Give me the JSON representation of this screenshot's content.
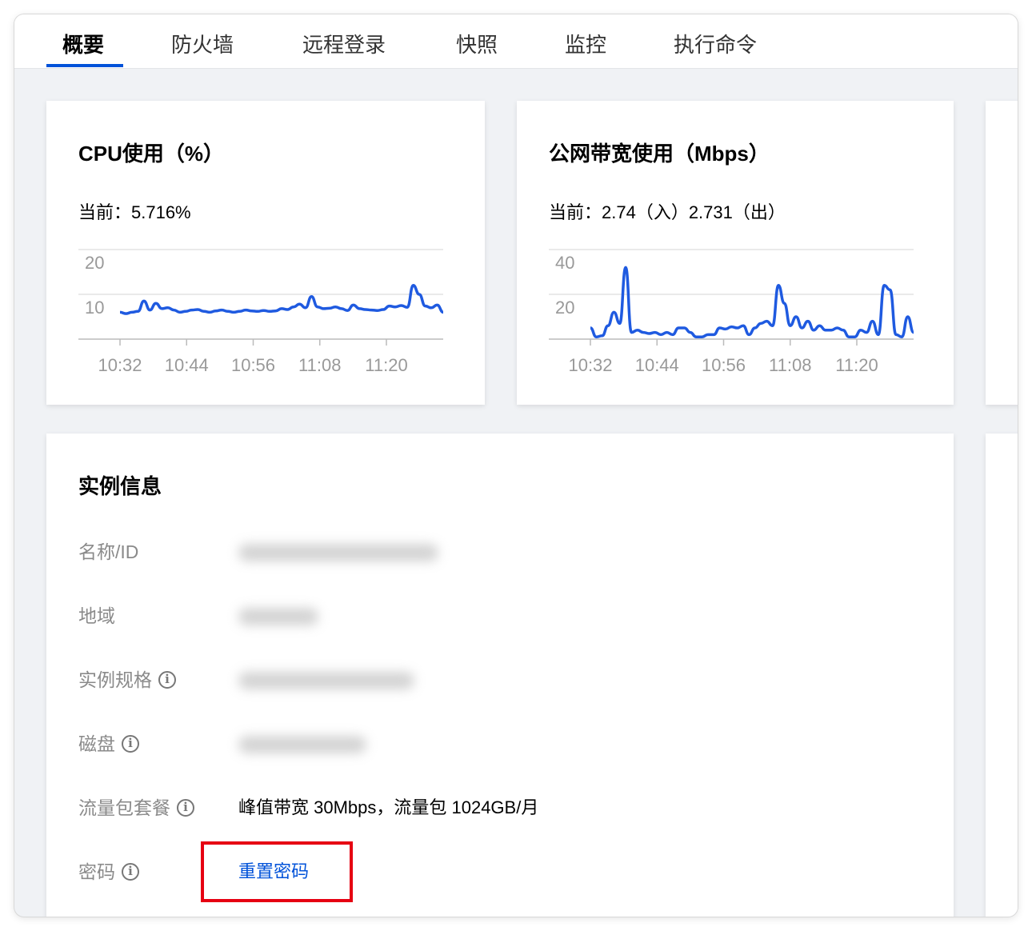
{
  "tabs": [
    {
      "label": "概要",
      "active": true
    },
    {
      "label": "防火墙",
      "active": false
    },
    {
      "label": "远程登录",
      "active": false
    },
    {
      "label": "快照",
      "active": false
    },
    {
      "label": "监控",
      "active": false
    },
    {
      "label": "执行命令",
      "active": false
    }
  ],
  "cpu_card": {
    "title": "CPU使用（%）",
    "current": "当前：5.716%"
  },
  "bandwidth_card": {
    "title": "公网带宽使用（Mbps）",
    "current": "当前：2.74（入）2.731（出）"
  },
  "chart_data": [
    {
      "type": "line",
      "title": "CPU使用（%）",
      "x_ticks": [
        "10:32",
        "10:44",
        "10:56",
        "11:08",
        "11:20"
      ],
      "ylim": [
        0,
        20
      ],
      "y_ticks": [
        10,
        20
      ],
      "grid": true,
      "series": [
        {
          "values": [
            6,
            5.7,
            6,
            6.2,
            8.5,
            6.5,
            8,
            6.8,
            7,
            6.5,
            6,
            6.2,
            6.5,
            6.6,
            6.2,
            6,
            6.3,
            6.5,
            6.2,
            6,
            6.2,
            6.5,
            6.3,
            6.2,
            6.4,
            6.2,
            6.3,
            6.8,
            6.6,
            7.2,
            7.8,
            7,
            9.5,
            7.2,
            6.8,
            6.9,
            7.2,
            6.8,
            6.4,
            7.6,
            6.8,
            6.6,
            6.5,
            6.4,
            6.6,
            7.4,
            7.2,
            7.5,
            7.1,
            12,
            10,
            7.4,
            7,
            7.6,
            6
          ]
        }
      ],
      "color": "#1f5ae0"
    },
    {
      "type": "line",
      "title": "公网带宽使用（Mbps）",
      "x_ticks": [
        "10:32",
        "10:44",
        "10:56",
        "11:08",
        "11:20"
      ],
      "ylim": [
        0,
        40
      ],
      "y_ticks": [
        20,
        40
      ],
      "grid": true,
      "series": [
        {
          "values": [
            5,
            1,
            1.5,
            6,
            12,
            7,
            32,
            3,
            4,
            3,
            2.5,
            3,
            2,
            3,
            2,
            5,
            5,
            3,
            1,
            1,
            2,
            2,
            5,
            4.5,
            5.5,
            5,
            6,
            2,
            5,
            7,
            8,
            6,
            24,
            16,
            6,
            10,
            5,
            8,
            4,
            6,
            4,
            4,
            5,
            4,
            1,
            1,
            4,
            3,
            8,
            2,
            24,
            22,
            2,
            1,
            10,
            3
          ]
        }
      ],
      "color": "#1f5ae0"
    }
  ],
  "instance": {
    "title": "实例信息",
    "rows": [
      {
        "label": "名称/ID",
        "info": false
      },
      {
        "label": "地域",
        "info": false
      },
      {
        "label": "实例规格",
        "info": true
      },
      {
        "label": "磁盘",
        "info": true
      },
      {
        "label": "流量包套餐",
        "info": true,
        "value": "峰值带宽 30Mbps，流量包 1024GB/月"
      },
      {
        "label": "密码",
        "info": true,
        "link": "重置密码"
      }
    ]
  },
  "colors": {
    "accent": "#0052d9",
    "highlight": "#e60012",
    "line": "#1f5ae0"
  }
}
